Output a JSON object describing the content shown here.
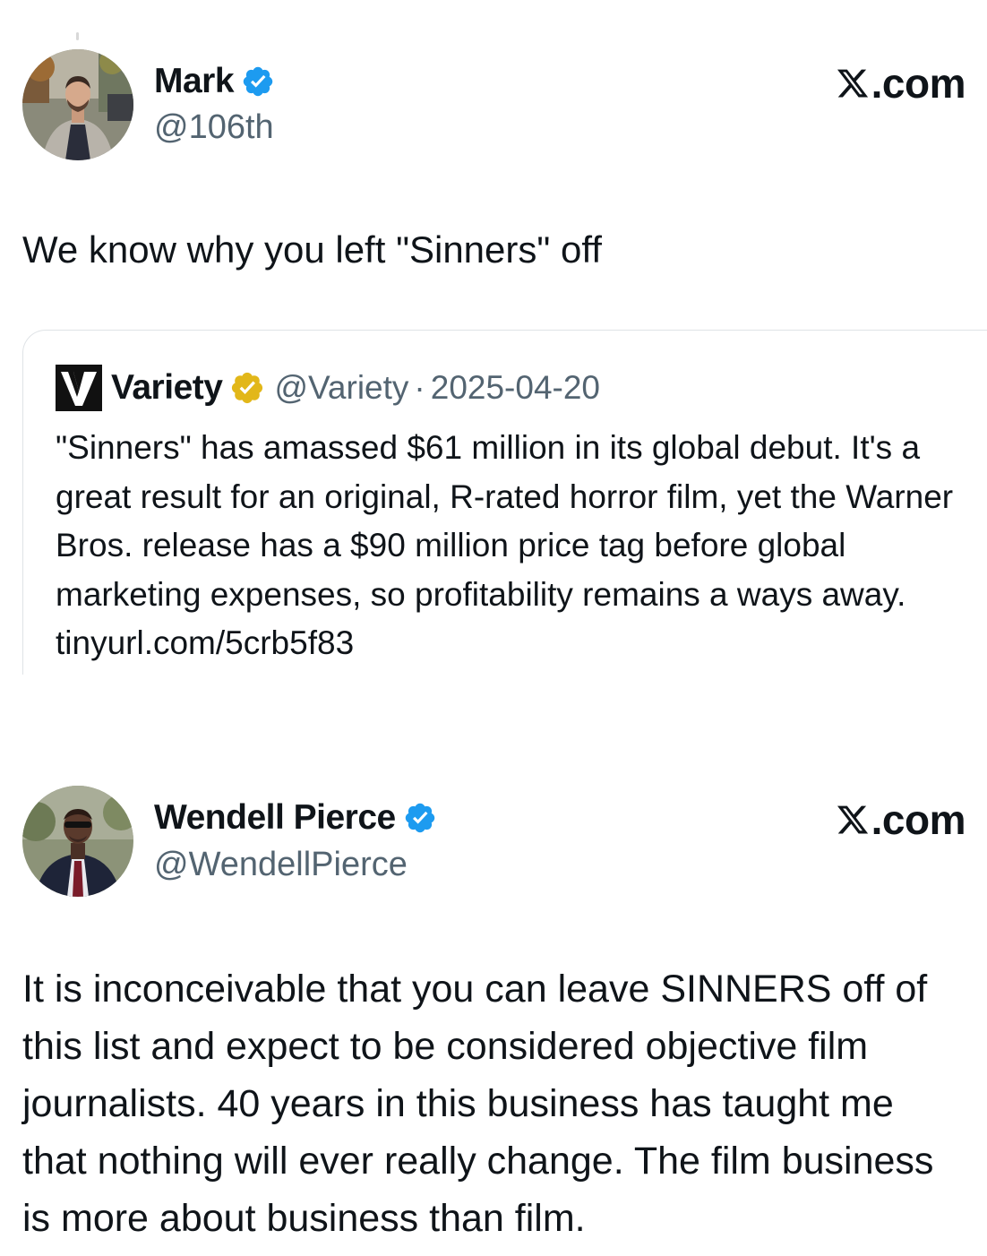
{
  "tweets": [
    {
      "author": {
        "name": "Mark",
        "handle": "@106th",
        "verified": true,
        "verified_color": "#1d9bf0"
      },
      "source_label": ".com",
      "text": "We know why you left \"Sinners\" off",
      "quote": {
        "author": {
          "name": "Variety",
          "handle": "@Variety",
          "verified": true,
          "verified_color": "#e2b719",
          "logo_icon": "variety-v-logo-icon"
        },
        "separator": "·",
        "date": "2025-04-20",
        "text": "\"Sinners\" has amassed $61 million in its global debut. It's a great result for an original, R-rated horror film, yet the Warner Bros. release has a $90 million price tag before global marketing expenses, so profitability remains a ways away. tinyurl.com/5crb5f83"
      }
    },
    {
      "author": {
        "name": "Wendell Pierce",
        "handle": "@WendellPierce",
        "verified": true,
        "verified_color": "#1d9bf0"
      },
      "source_label": ".com",
      "text": "It is inconceivable that you can leave SINNERS off of this list and expect to be considered objective film journalists. 40 years in this business has taught me that nothing will ever really change. The film business is more about business than film."
    }
  ],
  "colors": {
    "text_primary": "#0f1419",
    "text_secondary": "#536471",
    "border": "#dfe3e6",
    "background": "#ffffff"
  }
}
